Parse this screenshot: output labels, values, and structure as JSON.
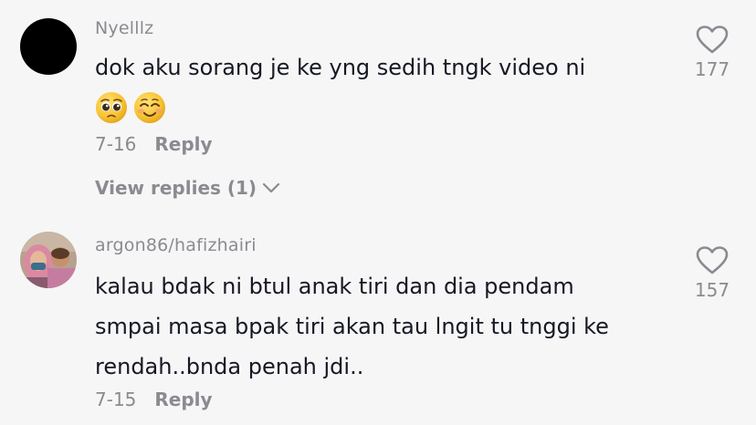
{
  "comments": [
    {
      "username": "Nyelllz",
      "text_lines": [
        "dok aku sorang je ke yng sedih tngk video ni"
      ],
      "emojis": [
        "pleading-face-emoji",
        "smiling-face-emoji"
      ],
      "date": "7-16",
      "reply_label": "Reply",
      "view_replies": "View replies (1)",
      "likes": "177"
    },
    {
      "username": "argon86/hafizhairi",
      "text_lines": [
        "kalau bdak ni btul anak tiri dan dia pendam",
        "smpai masa bpak tiri akan tau lngit tu tnggi ke",
        "rendah..bnda penah jdi.."
      ],
      "date": "7-15",
      "reply_label": "Reply",
      "likes": "157"
    }
  ],
  "colors": {
    "background": "#f6f6f6",
    "text": "#161823",
    "muted": "#8a8b91"
  }
}
